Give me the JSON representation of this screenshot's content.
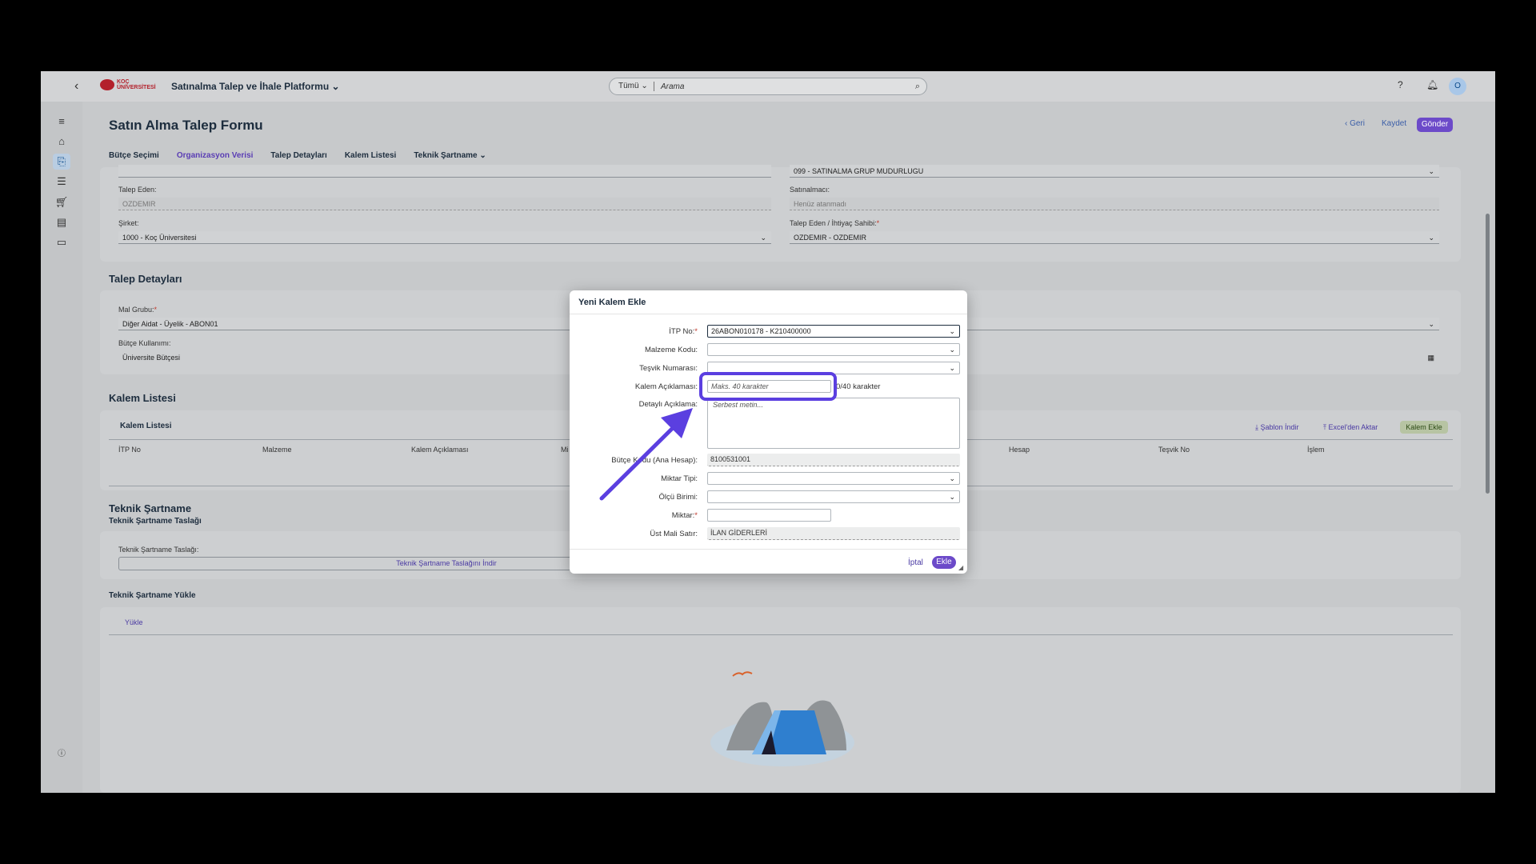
{
  "shell": {
    "back": "‹",
    "logo_line1": "KOÇ",
    "logo_line2": "ÜNİVERSİTESİ",
    "app_title": "Satınalma Talep ve İhale Platformu",
    "search_scope": "Tümü",
    "search_placeholder": "Arama",
    "avatar": "O"
  },
  "header": {
    "title": "Satın Alma Talep Formu",
    "geri": "Geri",
    "kaydet": "Kaydet",
    "gonder": "Gönder"
  },
  "tabs": [
    "Bütçe Seçimi",
    "Organizasyon Verisi",
    "Talep Detayları",
    "Kalem Listesi",
    "Teknik Şartname"
  ],
  "org": {
    "top_right_value": "099 - SATINALMA GRUP MUDURLUGU",
    "talep_eden_label": "Talep Eden:",
    "talep_eden_value": "OZDEMIR",
    "satinalmaci_label": "Satınalmacı:",
    "satinalmaci_value": "Henüz atanmadı",
    "sirket_label": "Şirket:",
    "sirket_value": "1000 - Koç Üniversitesi",
    "ihtiyac_label": "Talep Eden / İhtiyaç Sahibi:",
    "ihtiyac_value": "OZDEMIR - OZDEMIR"
  },
  "talep": {
    "title": "Talep Detayları",
    "mal_grubu_label": "Mal Grubu:",
    "mal_grubu_value": "Diğer Aidat - Üyelik - ABON01",
    "butce_label": "Bütçe Kullanımı:",
    "butce_value": "Üniversite Bütçesi"
  },
  "kalem": {
    "title": "Kalem Listesi",
    "table_title": "Kalem Listesi",
    "sablon": "Şablon İndir",
    "excel": "Excel'den Aktar",
    "ekle": "Kalem Ekle",
    "cols": [
      "İTP No",
      "Malzeme",
      "Kalem Açıklaması",
      "Mi",
      "Hesap",
      "Teşvik No",
      "İşlem"
    ]
  },
  "teknik": {
    "title": "Teknik Şartname",
    "sub": "Teknik Şartname Taslağı",
    "label": "Teknik Şartname Taslağı:",
    "download": "Teknik Şartname Taslağını İndir",
    "yukle_title": "Teknik Şartname Yükle",
    "yukle_tab": "Yükle"
  },
  "dialog": {
    "title": "Yeni Kalem Ekle",
    "itp_label": "İTP No:",
    "itp_value": "26ABON010178 - K210400000",
    "malzeme_label": "Malzeme Kodu:",
    "tesvik_label": "Teşvik Numarası:",
    "kalem_label": "Kalem Açıklaması:",
    "kalem_placeholder": "Maks. 40 karakter",
    "kalem_counter": "0/40 karakter",
    "detay_label": "Detaylı Açıklama:",
    "detay_placeholder": "Serbest metin...",
    "butce_label": "Bütçe Kodu (Ana Hesap):",
    "butce_value": "8100531001",
    "miktar_tipi_label": "Miktar Tipi:",
    "olcu_label": "Ölçü Birimi:",
    "miktar_label": "Miktar:",
    "ust_label": "Üst Mali Satır:",
    "ust_value": "İLAN GİDERLERİ",
    "iptal": "İptal",
    "ekle": "Ekle"
  },
  "colors": {
    "accent": "#6c4ac9",
    "highlight": "#5b3fe0"
  }
}
